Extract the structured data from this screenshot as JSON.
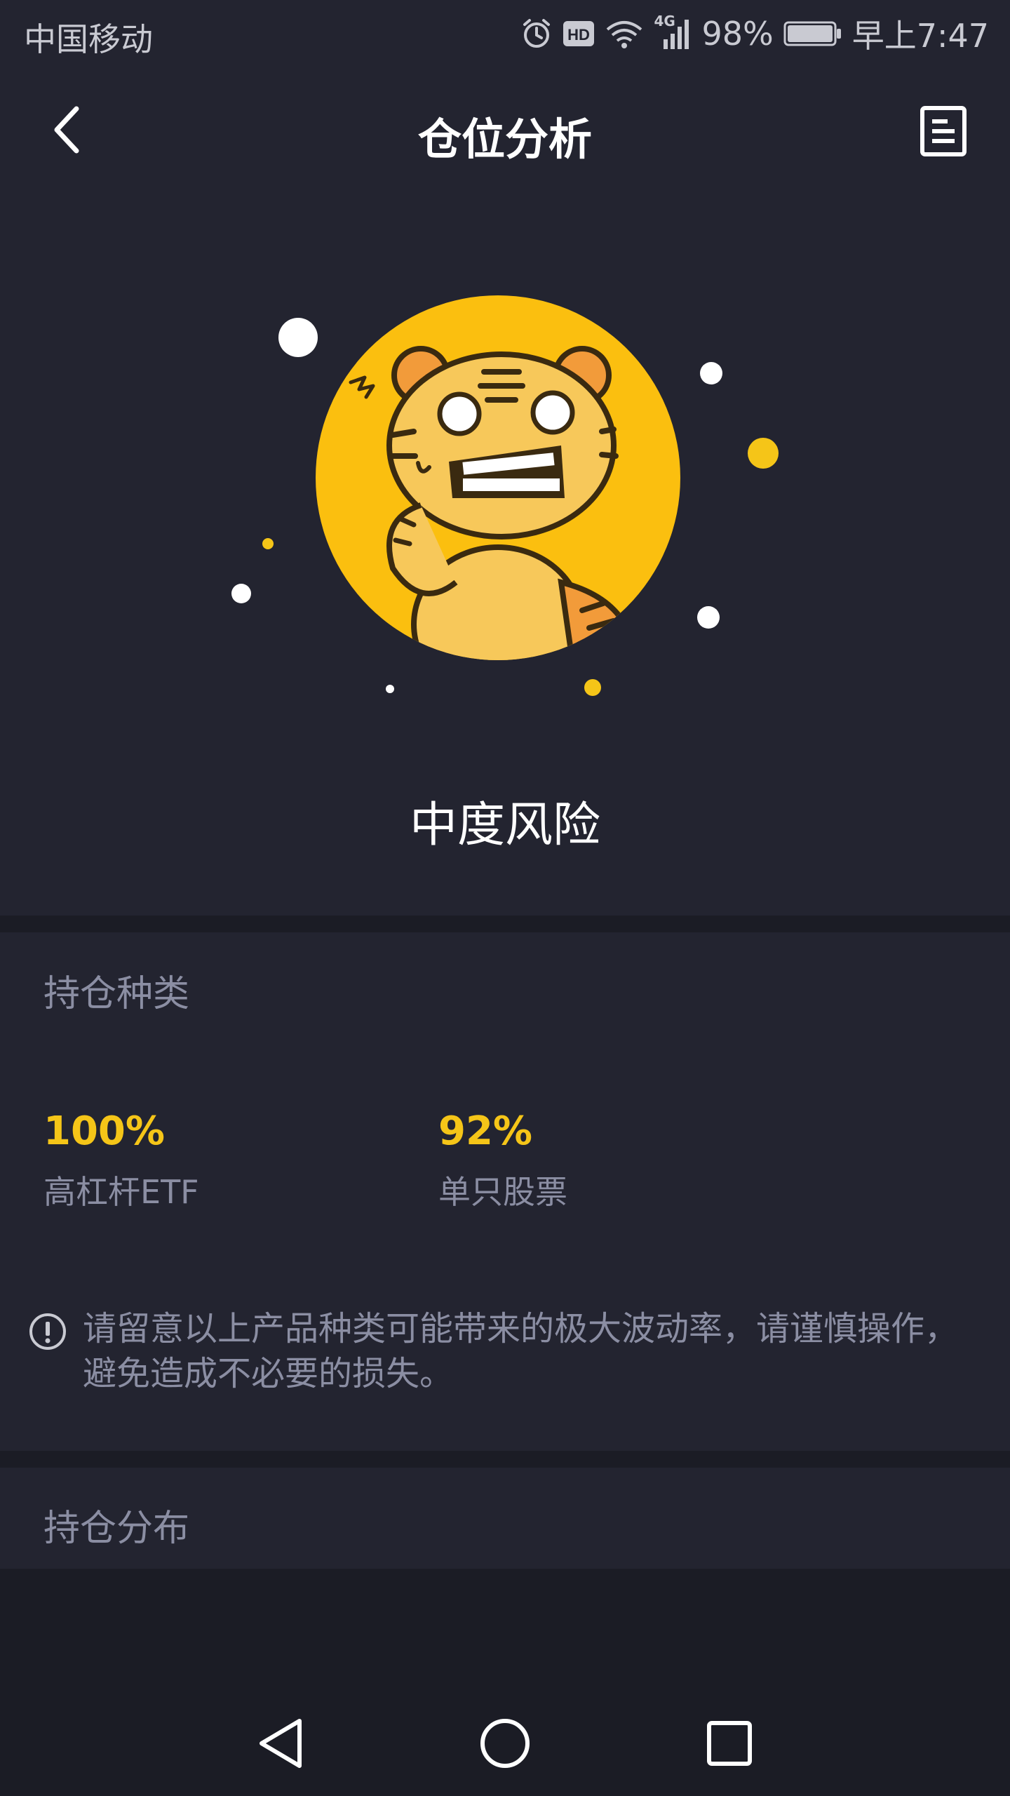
{
  "status_bar": {
    "carrier": "中国移动",
    "network": "4G",
    "battery": "98%",
    "time": "早上7:47"
  },
  "header": {
    "title": "仓位分析"
  },
  "hero": {
    "risk_level": "中度风险"
  },
  "holdings_type": {
    "title": "持仓种类",
    "items": [
      {
        "value": "100%",
        "label": "高杠杆ETF"
      },
      {
        "value": "92%",
        "label": "单只股票"
      }
    ],
    "notice": "请留意以上产品种类可能带来的极大波动率，请谨慎操作，避免造成不必要的损失。"
  },
  "holdings_distribution": {
    "title": "持仓分布"
  },
  "colors": {
    "background": "#232430",
    "accent": "#f5c518",
    "muted_text": "#8b8ea3",
    "divider": "#1b1c25"
  }
}
